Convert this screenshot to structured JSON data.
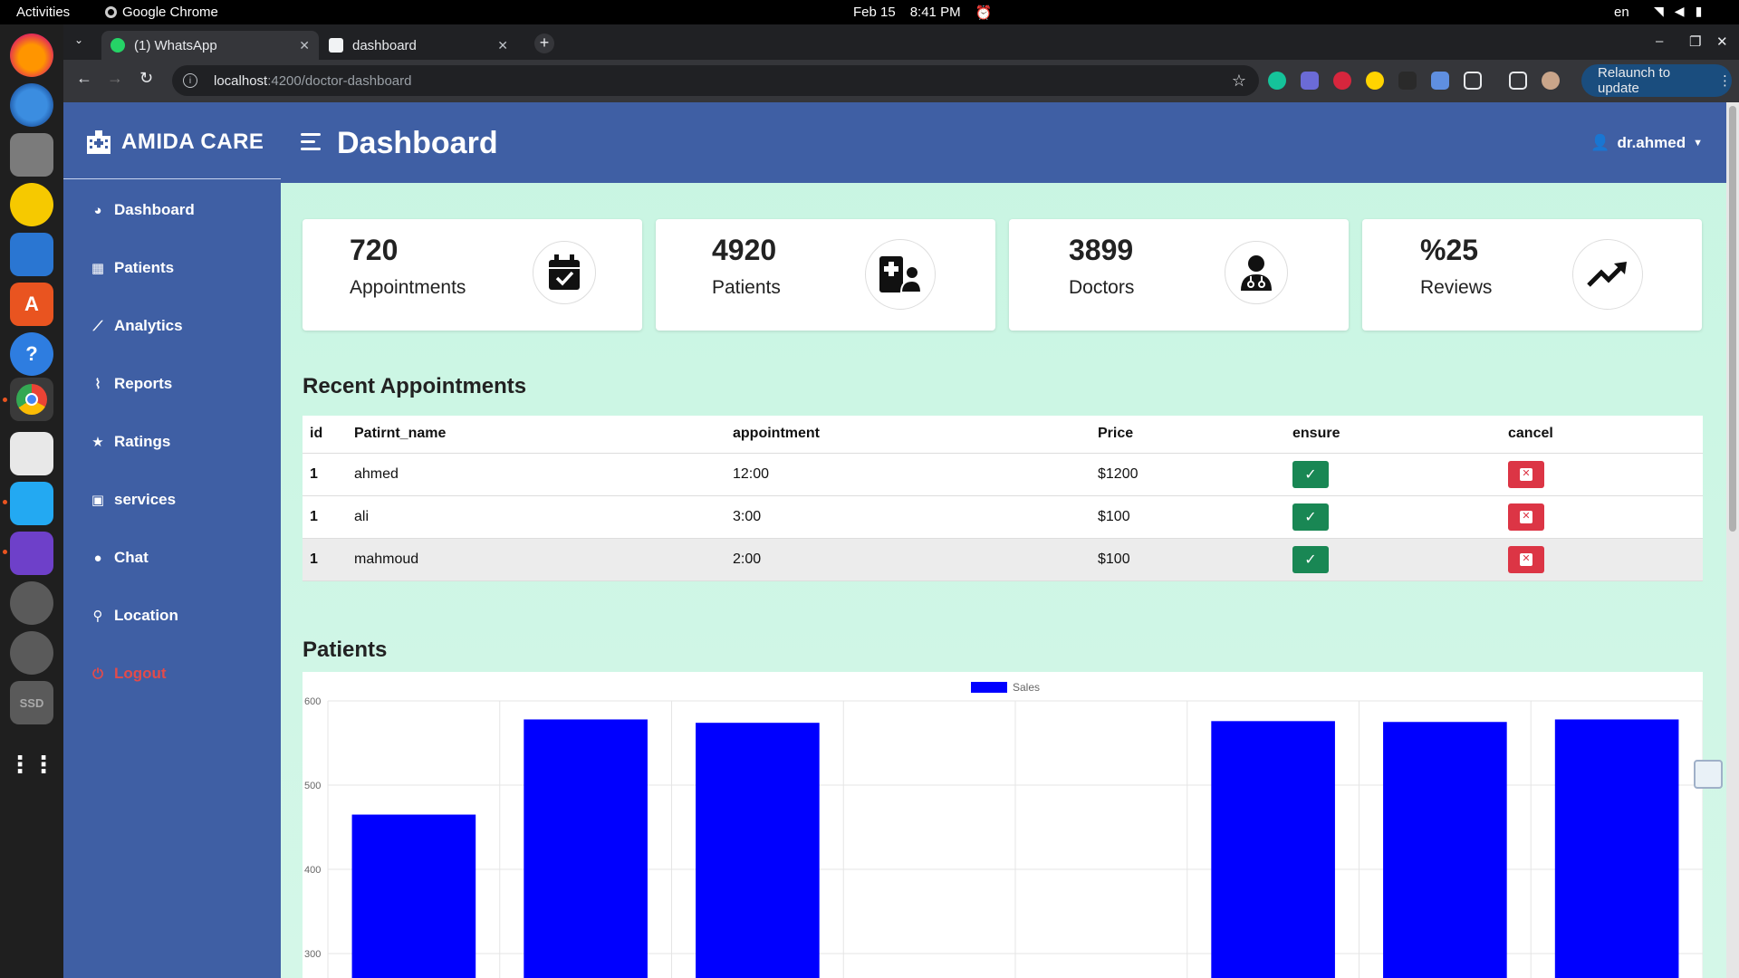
{
  "topbar": {
    "activities": "Activities",
    "app": "Google Chrome",
    "date": "Feb 15",
    "time": "8:41 PM",
    "lang": "en"
  },
  "browser": {
    "tabs": [
      {
        "label": "(1) WhatsApp",
        "favicon_color": "#25d366"
      },
      {
        "label": "dashboard",
        "favicon_color": "#f1f3f4"
      }
    ],
    "url_host": "localhost",
    "url_path": ":4200/doctor-dashboard",
    "relaunch": "Relaunch to update"
  },
  "sidebar": {
    "brand": "AMIDA CARE",
    "items": [
      {
        "label": "Dashboard",
        "icon": "palette-icon"
      },
      {
        "label": "Patients",
        "icon": "hospital-user-icon"
      },
      {
        "label": "Analytics",
        "icon": "chart-line-icon"
      },
      {
        "label": "Reports",
        "icon": "paperclip-icon"
      },
      {
        "label": "Ratings",
        "icon": "star-icon"
      },
      {
        "label": "services",
        "icon": "gift-icon"
      },
      {
        "label": "Chat",
        "icon": "comment-icon"
      },
      {
        "label": "Location",
        "icon": "map-pin-icon"
      },
      {
        "label": "Logout",
        "icon": "power-icon"
      }
    ]
  },
  "header": {
    "title": "Dashboard",
    "user": "dr.ahmed"
  },
  "cards": [
    {
      "value": "720",
      "label": "Appointments",
      "icon": "calendar-check-icon"
    },
    {
      "value": "4920",
      "label": "Patients",
      "icon": "hospital-user-icon"
    },
    {
      "value": "3899",
      "label": "Doctors",
      "icon": "user-doctor-icon"
    },
    {
      "value": "%25",
      "label": "Reviews",
      "icon": "trend-up-icon"
    }
  ],
  "appointments": {
    "title": "Recent Appointments",
    "columns": [
      "id",
      "Patirnt_name",
      "appointment",
      "Price",
      "ensure",
      "cancel"
    ],
    "rows": [
      {
        "id": "1",
        "name": "ahmed",
        "time": "12:00",
        "price": "$1200"
      },
      {
        "id": "1",
        "name": "ali",
        "time": "3:00",
        "price": "$100"
      },
      {
        "id": "1",
        "name": "mahmoud",
        "time": "2:00",
        "price": "$100"
      }
    ]
  },
  "patients_section": {
    "title": "Patients"
  },
  "chart_data": {
    "type": "bar",
    "title": "",
    "xlabel": "",
    "ylabel": "",
    "legend": "top-center",
    "grid": true,
    "series": [
      {
        "name": "Sales",
        "color": "#0000ff",
        "values": [
          465,
          578,
          574,
          null,
          null,
          576,
          575,
          578
        ]
      }
    ],
    "categories": [
      "",
      "",
      "",
      "",
      "",
      "",
      "",
      ""
    ],
    "yticks": [
      600,
      500,
      400,
      300
    ],
    "ylim_visible": [
      295,
      600
    ]
  }
}
